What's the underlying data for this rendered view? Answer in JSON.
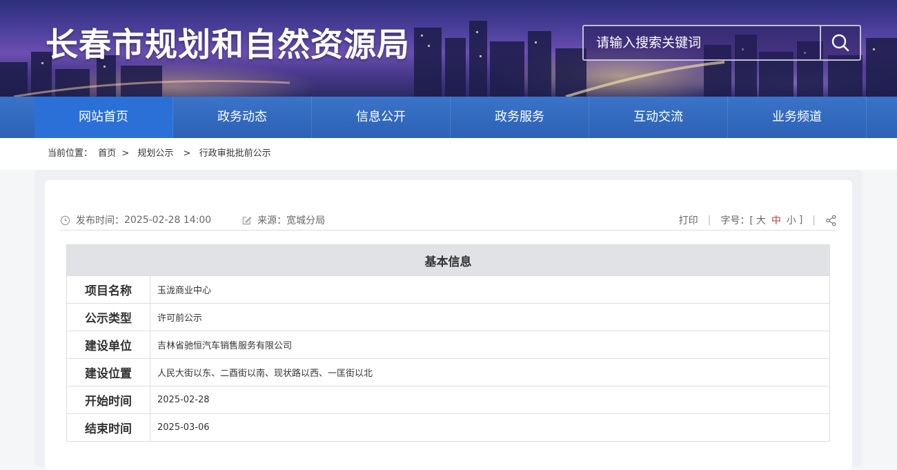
{
  "header": {
    "site_title": "长春市规划和自然资源局",
    "search_placeholder": "请输入搜索关键词",
    "search_icon": "search-icon"
  },
  "nav": {
    "items": [
      {
        "label": "网站首页",
        "active": true
      },
      {
        "label": "政务动态"
      },
      {
        "label": "信息公开"
      },
      {
        "label": "政务服务"
      },
      {
        "label": "互动交流"
      },
      {
        "label": "业务频道"
      }
    ]
  },
  "breadcrumb": {
    "prefix": "当前位置：",
    "items": [
      "首页",
      "规划公示",
      "行政审批批前公示"
    ],
    "separator": ">"
  },
  "article_meta": {
    "publish_label": "发布时间：",
    "publish_time": "2025-02-28 14:00",
    "source_label": "来源：",
    "source": "宽城分局",
    "print_label": "打印",
    "font_size_label": "字号：[",
    "font_size_close": "]",
    "font_sizes": [
      "大",
      "中",
      "小"
    ],
    "share_icon": "share-icon",
    "clock_icon": "clock-icon",
    "edit_icon": "edit-icon"
  },
  "info_table": {
    "heading": "基本信息",
    "rows": [
      {
        "key": "项目名称",
        "value": "玉泷商业中心"
      },
      {
        "key": "公示类型",
        "value": "许可前公示"
      },
      {
        "key": "建设单位",
        "value": "吉林省驰恒汽车销售服务有限公司"
      },
      {
        "key": "建设位置",
        "value": "人民大街以东、二酉街以南、现状路以西、一匡街以北"
      },
      {
        "key": "开始时间",
        "value": "2025-02-28"
      },
      {
        "key": "结束时间",
        "value": "2025-03-06"
      }
    ]
  },
  "colors": {
    "nav_bg": "#2c62b6",
    "nav_active": "#2a70d6",
    "table_header_bg": "#e1e2e6",
    "font_size_active": "#c0392b"
  }
}
